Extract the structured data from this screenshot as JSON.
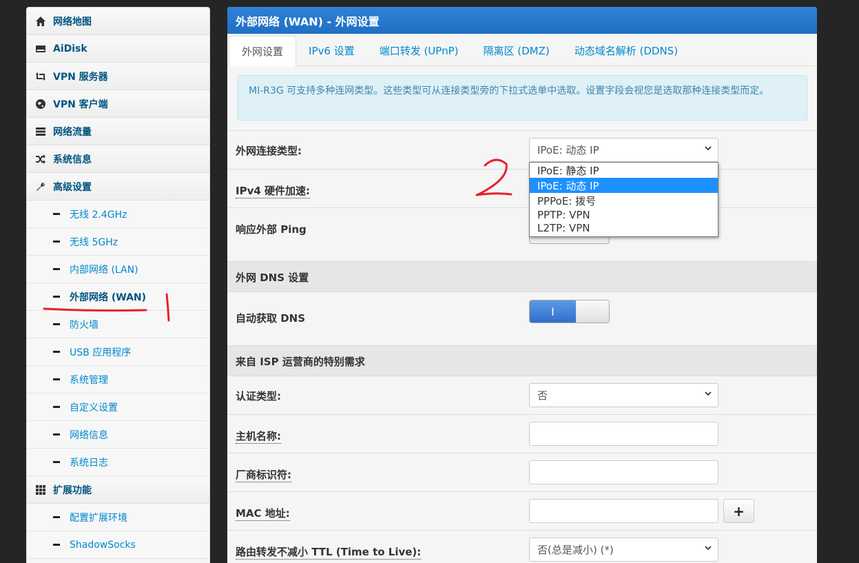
{
  "sidebar": {
    "items": [
      {
        "label": "网络地图",
        "icon": "home-icon"
      },
      {
        "label": "AiDisk",
        "icon": "hdd-icon"
      },
      {
        "label": "VPN 服务器",
        "icon": "retweet-icon"
      },
      {
        "label": "VPN 客户端",
        "icon": "globe-icon"
      },
      {
        "label": "网络流量",
        "icon": "tasks-icon"
      },
      {
        "label": "系统信息",
        "icon": "shuffle-icon"
      },
      {
        "label": "高级设置",
        "icon": "wrench-icon"
      }
    ],
    "sub_items": [
      {
        "label": "无线 2.4GHz"
      },
      {
        "label": "无线 5GHz"
      },
      {
        "label": "内部网络 (LAN)"
      },
      {
        "label": "外部网络 (WAN)",
        "active": true
      },
      {
        "label": "防火墙"
      },
      {
        "label": "USB 应用程序"
      },
      {
        "label": "系统管理"
      },
      {
        "label": "自定义设置"
      },
      {
        "label": "网络信息"
      },
      {
        "label": "系统日志"
      }
    ],
    "ext": {
      "label": "扩展功能",
      "icon": "th-icon"
    },
    "ext_sub_items": [
      {
        "label": "配置扩展环境"
      },
      {
        "label": "ShadowSocks"
      }
    ]
  },
  "panel": {
    "title": "外部网络 (WAN) - 外网设置",
    "tabs": [
      "外网设置",
      "IPv6 设置",
      "端口转发 (UPnP)",
      "隔离区 (DMZ)",
      "动态域名解析 (DDNS)"
    ],
    "active_tab": 0,
    "info": "MI-R3G 可支持多种连网类型。这些类型可从连接类型旁的下拉式选单中选取。设置字段会视您是选取那种连接类型而定。"
  },
  "form": {
    "wan_type_label": "外网连接类型:",
    "wan_type_value": "IPoE: 动态 IP",
    "hw_accel_label": "IPv4 硬件加速:",
    "ping_label": "响应外部 Ping",
    "dns_section": "外网 DNS 设置",
    "auto_dns_label": "自动获取 DNS",
    "auto_dns_toggle": "I",
    "isp_section": "来自 ISP 运营商的特别需求",
    "auth_label": "认证类型:",
    "auth_value": "否",
    "hostname_label": "主机名称:",
    "vendor_label": "厂商标识符:",
    "mac_label": "MAC 地址:",
    "mac_button": "+",
    "ttl_label": "路由转发不减小 TTL (Time to Live):",
    "ttl_value": "否(总是减小) (*)"
  },
  "dropdown": {
    "options": [
      "IPoE: 静态 IP",
      "IPoE: 动态 IP",
      "PPPoE: 拨号",
      "PPTP: VPN",
      "L2TP: VPN"
    ],
    "selected_index": 1
  },
  "colors": {
    "header_blue": "#2f82d6",
    "link_blue": "#0088cc",
    "annotation_red": "#e8202a",
    "selected_option": "#1e90ff"
  }
}
